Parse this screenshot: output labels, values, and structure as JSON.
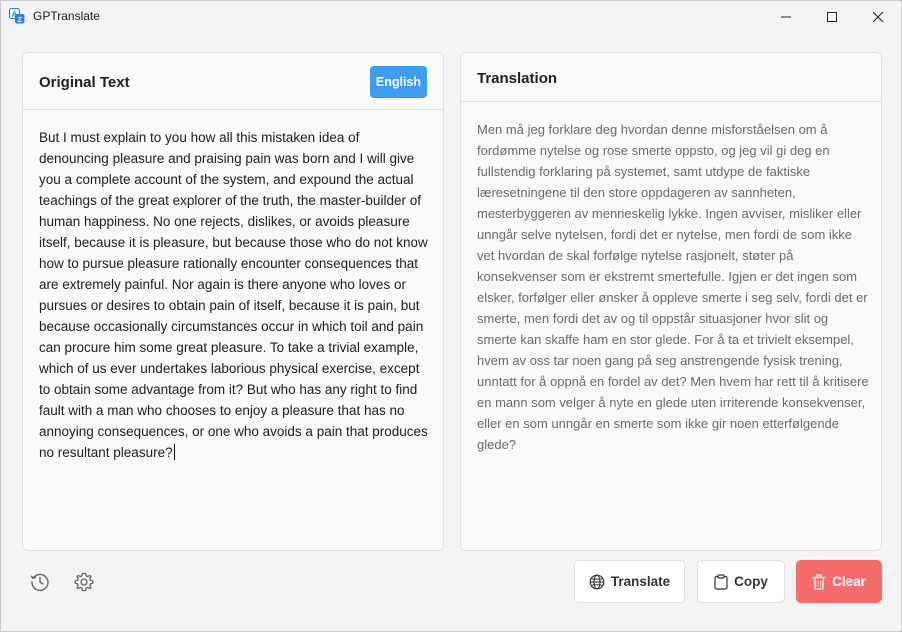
{
  "window": {
    "title": "GPTranslate"
  },
  "source": {
    "title": "Original Text",
    "language": "English",
    "text": "But I must explain to you how all this mistaken idea of denouncing pleasure and praising pain was born and I will give you a complete account of the system, and expound the actual teachings of the great explorer of the truth, the master-builder of human happiness. No one rejects, dislikes, or avoids pleasure itself, because it is pleasure, but because those who do not know how to pursue pleasure rationally encounter consequences that are extremely painful. Nor again is there anyone who loves or pursues or desires to obtain pain of itself, because it is pain, but because occasionally circumstances occur in which toil and pain can procure him some great pleasure. To take a trivial example, which of us ever undertakes laborious physical exercise, except to obtain some advantage from it? But who has any right to find fault with a man who chooses to enjoy a pleasure that has no annoying consequences, or one who avoids a pain that produces no resultant pleasure?"
  },
  "translation": {
    "title": "Translation",
    "text": "Men må jeg forklare deg hvordan denne misforståelsen om å fordømme nytelse og rose smerte oppsto, og jeg vil gi deg en fullstendig forklaring på systemet, samt utdype de faktiske læresetningene til den store oppdageren av sannheten, mesterbyggeren av menneskelig lykke. Ingen avviser, misliker eller unngår selve nytelsen, fordi det er nytelse, men fordi de som ikke vet hvordan de skal forfølge nytelse rasjonelt, støter på konsekvenser som er ekstremt smertefulle. Igjen er det ingen som elsker, forfølger eller ønsker å oppleve smerte i seg selv, fordi det er smerte, men fordi det av og til oppstår situasjoner hvor slit og smerte kan skaffe ham en stor glede. For å ta et trivielt eksempel, hvem av oss tar noen gang på seg anstrengende fysisk trening, unntatt for å oppnå en fordel av det? Men hvem har rett til å kritisere en mann som velger å nyte en glede uten irriterende konsekvenser, eller en som unngår en smerte som ikke gir noen etterfølgende glede?"
  },
  "actions": {
    "translate_label": "Translate",
    "copy_label": "Copy",
    "clear_label": "Clear"
  },
  "icons": {
    "app": "translate-app-icon",
    "history": "history-icon",
    "settings": "gear-icon",
    "translate": "globe-icon",
    "copy": "clipboard-icon",
    "clear": "trash-icon"
  },
  "colors": {
    "accent": "#3d9ced",
    "danger": "#f56c6c"
  }
}
